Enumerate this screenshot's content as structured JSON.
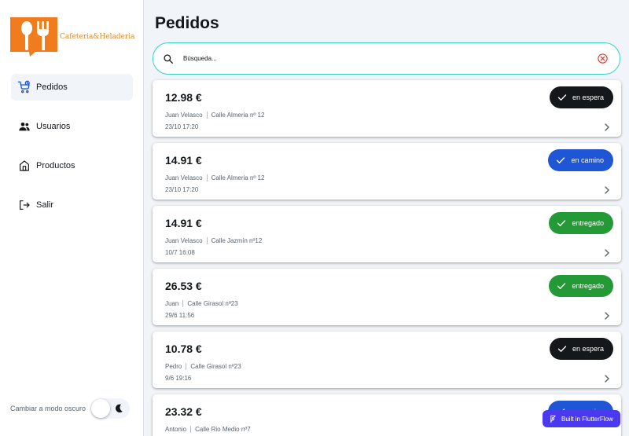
{
  "sidebar": {
    "brand": "Cafeteria&Heladeria",
    "brand_color": "#f07c1e",
    "items": [
      {
        "label": "Pedidos",
        "icon": "shopping-cart-icon",
        "active": true
      },
      {
        "label": "Usuarios",
        "icon": "users-icon",
        "active": false
      },
      {
        "label": "Productos",
        "icon": "store-icon",
        "active": false
      },
      {
        "label": "Salir",
        "icon": "logout-icon",
        "active": false
      }
    ],
    "dark_mode_label": "Cambiar a modo oscuro",
    "dark_mode_on": false
  },
  "main": {
    "title": "Pedidos",
    "search": {
      "placeholder": "Búsqueda...",
      "value": ""
    },
    "orders": [
      {
        "price": "12.98 €",
        "customer": "Juan Velasco",
        "address": "Calle Almeria nº 12",
        "date": "23/10 17:20",
        "status": "en espera",
        "status_color": "#14181b"
      },
      {
        "price": "14.91 €",
        "customer": "Juan Velasco",
        "address": "Calle Almeria nº 12",
        "date": "23/10 17:20",
        "status": "en camino",
        "status_color": "#1e56d6"
      },
      {
        "price": "14.91 €",
        "customer": "Juan Velasco",
        "address": "Calle Jazmín nº12",
        "date": "10/7 16:08",
        "status": "entregado",
        "status_color": "#249a36"
      },
      {
        "price": "26.53 €",
        "customer": "Juan",
        "address": "Calle Girasol nº23",
        "date": "29/6 11:56",
        "status": "entregado",
        "status_color": "#249a36"
      },
      {
        "price": "10.78 €",
        "customer": "Pedro",
        "address": "Calle Girasol nº23",
        "date": "9/6 19:16",
        "status": "en espera",
        "status_color": "#14181b"
      },
      {
        "price": "23.32 €",
        "customer": "Antonio",
        "address": "Calle Rio Medio nº7",
        "date": "",
        "status": "en camino",
        "status_color": "#1e56d6"
      }
    ]
  },
  "flutterflow_badge": "Built in FlutterFlow"
}
